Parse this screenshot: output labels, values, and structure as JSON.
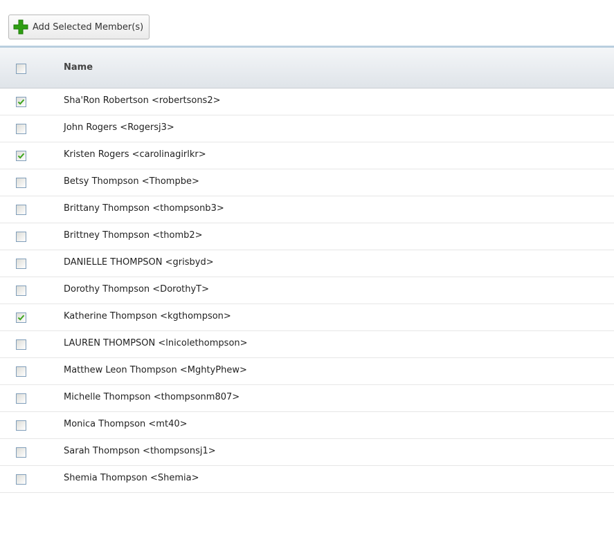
{
  "toolbar": {
    "add_label": "Add Selected Member(s)"
  },
  "grid": {
    "header": {
      "name_label": "Name",
      "select_all_checked": false
    },
    "rows": [
      {
        "label": "Sha'Ron Robertson <robertsons2>",
        "checked": true
      },
      {
        "label": "John Rogers <Rogersj3>",
        "checked": false
      },
      {
        "label": "Kristen Rogers <carolinagirlkr>",
        "checked": true
      },
      {
        "label": "Betsy Thompson <Thompbe>",
        "checked": false
      },
      {
        "label": "Brittany Thompson <thompsonb3>",
        "checked": false
      },
      {
        "label": "Brittney Thompson <thomb2>",
        "checked": false
      },
      {
        "label": "DANIELLE THOMPSON <grisbyd>",
        "checked": false
      },
      {
        "label": "Dorothy Thompson <DorothyT>",
        "checked": false
      },
      {
        "label": "Katherine Thompson <kgthompson>",
        "checked": true
      },
      {
        "label": "LAUREN THOMPSON <lnicolethompson>",
        "checked": false
      },
      {
        "label": "Matthew Leon Thompson <MghtyPhew>",
        "checked": false
      },
      {
        "label": "Michelle Thompson <thompsonm807>",
        "checked": false
      },
      {
        "label": "Monica Thompson <mt40>",
        "checked": false
      },
      {
        "label": "Sarah Thompson <thompsonsj1>",
        "checked": false
      },
      {
        "label": "Shemia Thompson <Shemia>",
        "checked": false
      }
    ]
  },
  "colors": {
    "accent": "#b9cedf",
    "check": "#3fa61f",
    "plus": "#2e9e12"
  }
}
